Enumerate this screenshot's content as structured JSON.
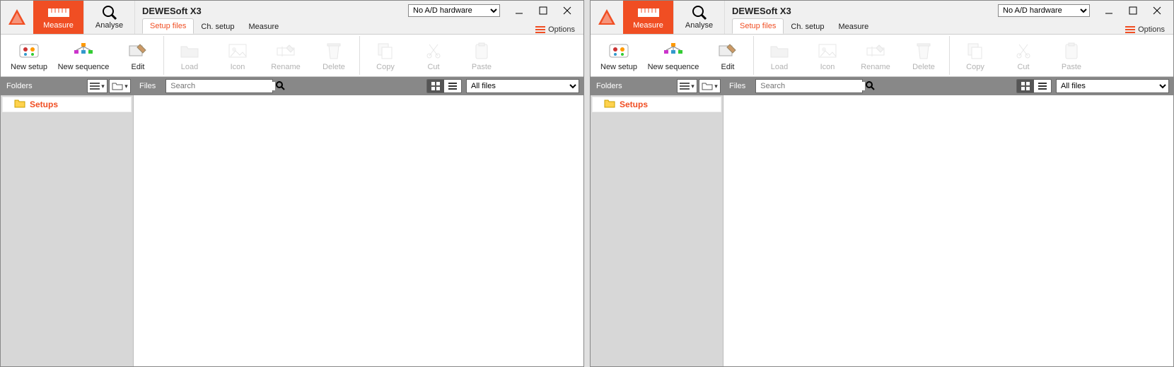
{
  "app_title": "DEWESoft X3",
  "hardware_status": "No A/D hardware",
  "options_label": "Options",
  "modes": {
    "measure": "Measure",
    "analyse": "Analyse"
  },
  "tabs": {
    "setup_files": "Setup files",
    "ch_setup": "Ch. setup",
    "measure": "Measure"
  },
  "toolbar": {
    "new_setup": "New setup",
    "new_sequence": "New sequence",
    "edit": "Edit",
    "load": "Load",
    "icon": "Icon",
    "rename": "Rename",
    "delete": "Delete",
    "copy": "Copy",
    "cut": "Cut",
    "paste": "Paste"
  },
  "panels": {
    "folders": "Folders",
    "files": "Files"
  },
  "search": {
    "placeholder": "Search"
  },
  "file_filter": {
    "selected": "All files"
  },
  "tree": {
    "setups": "Setups"
  }
}
